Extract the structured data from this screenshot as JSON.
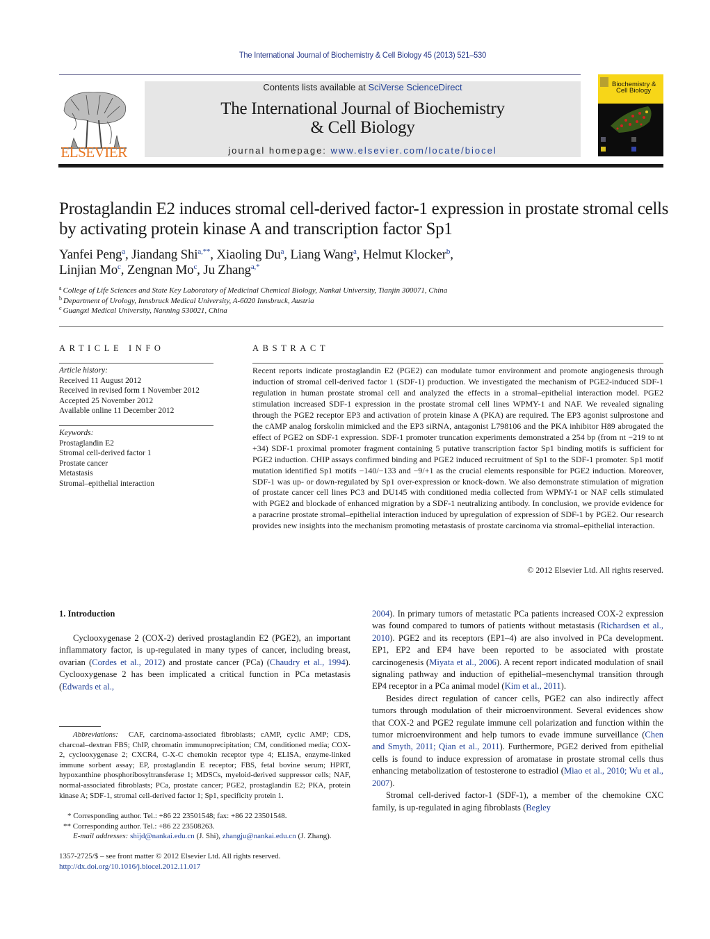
{
  "header": {
    "journal_ref": "The International Journal of Biochemistry & Cell Biology 45 (2013) 521–530",
    "contents_prefix": "Contents lists available at ",
    "contents_link": "SciVerse ScienceDirect",
    "journal_title_line1": "The International Journal of Biochemistry",
    "journal_title_line2": "& Cell Biology",
    "homepage_prefix": "journal homepage: ",
    "homepage_link": "www.elsevier.com/locate/biocel",
    "publisher_logo_text": "ELSEVIER",
    "cover_title_line1": "Biochemistry &",
    "cover_title_line2": "Cell Biology"
  },
  "article": {
    "title": "Prostaglandin E2 induces stromal cell-derived factor-1 expression in prostate stromal cells by activating protein kinase A and transcription factor Sp1",
    "authors": [
      {
        "name": "Yanfei Peng",
        "aff": "a"
      },
      {
        "name": "Jiandang Shi",
        "aff": "a,**"
      },
      {
        "name": "Xiaoling Du",
        "aff": "a"
      },
      {
        "name": "Liang Wang",
        "aff": "a"
      },
      {
        "name": "Helmut Klocker",
        "aff": "b"
      },
      {
        "name": "Linjian Mo",
        "aff": "c"
      },
      {
        "name": "Zengnan Mo",
        "aff": "c"
      },
      {
        "name": "Ju Zhang",
        "aff": "a,*"
      }
    ],
    "affiliations": [
      {
        "key": "a",
        "text": "College of Life Sciences and State Key Laboratory of Medicinal Chemical Biology, Nankai University, Tianjin 300071, China"
      },
      {
        "key": "b",
        "text": "Department of Urology, Innsbruck Medical University, A-6020 Innsbruck, Austria"
      },
      {
        "key": "c",
        "text": "Guangxi Medical University, Nanning 530021, China"
      }
    ]
  },
  "article_info": {
    "heading": "ARTICLE INFO",
    "history_label": "Article history:",
    "history": [
      "Received 11 August 2012",
      "Received in revised form 1 November 2012",
      "Accepted 25 November 2012",
      "Available online 11 December 2012"
    ],
    "keywords_label": "Keywords:",
    "keywords": [
      "Prostaglandin E2",
      "Stromal cell-derived factor 1",
      "Prostate cancer",
      "Metastasis",
      "Stromal–epithelial interaction"
    ]
  },
  "abstract": {
    "heading": "ABSTRACT",
    "text": "Recent reports indicate prostaglandin E2 (PGE2) can modulate tumor environment and promote angiogenesis through induction of stromal cell-derived factor 1 (SDF-1) production. We investigated the mechanism of PGE2-induced SDF-1 regulation in human prostate stromal cell and analyzed the effects in a stromal–epithelial interaction model. PGE2 stimulation increased SDF-1 expression in the prostate stromal cell lines WPMY-1 and NAF. We revealed signaling through the PGE2 receptor EP3 and activation of protein kinase A (PKA) are required. The EP3 agonist sulprostone and the cAMP analog forskolin mimicked and the EP3 siRNA, antagonist L798106 and the PKA inhibitor H89 abrogated the effect of PGE2 on SDF-1 expression. SDF-1 promoter truncation experiments demonstrated a 254 bp (from nt −219 to nt +34) SDF-1 proximal promoter fragment containing 5 putative transcription factor Sp1 binding motifs is sufficient for PGE2 induction. CHIP assays confirmed binding and PGE2 induced recruitment of Sp1 to the SDF-1 promoter. Sp1 motif mutation identified Sp1 motifs −140/−133 and −9/+1 as the crucial elements responsible for PGE2 induction. Moreover, SDF-1 was up- or down-regulated by Sp1 over-expression or knock-down. We also demonstrate stimulation of migration of prostate cancer cell lines PC3 and DU145 with conditioned media collected from WPMY-1 or NAF cells stimulated with PGE2 and blockade of enhanced migration by a SDF-1 neutralizing antibody. In conclusion, we provide evidence for a paracrine prostate stromal–epithelial interaction induced by upregulation of expression of SDF-1 by PGE2. Our research provides new insights into the mechanism promoting metastasis of prostate carcinoma via stromal–epithelial interaction.",
    "copyright": "© 2012 Elsevier Ltd. All rights reserved."
  },
  "introduction": {
    "heading": "1.  Introduction",
    "p1": [
      {
        "t": "Cyclooxygenase 2 (COX-2) derived prostaglandin E2 (PGE2), an important inflammatory factor, is up-regulated in many types of cancer, including breast, ovarian ("
      },
      {
        "t": "Cordes et al., 2012",
        "link": true
      },
      {
        "t": ") and prostate cancer (PCa) ("
      },
      {
        "t": "Chaudry et al., 1994",
        "link": true
      },
      {
        "t": "). Cyclooxygenase 2 has been implicated a critical function in PCa metastasis ("
      },
      {
        "t": "Edwards et al.,",
        "link": true
      }
    ],
    "p1_cont": [
      {
        "t": "2004",
        "link": true
      },
      {
        "t": "). In primary tumors of metastatic PCa patients increased COX-2 expression was found compared to tumors of patients without metastasis ("
      },
      {
        "t": "Richardsen et al., 2010",
        "link": true
      },
      {
        "t": "). PGE2 and its receptors (EP1–4) are also involved in PCa development. EP1, EP2 and EP4 have been reported to be associated with prostate carcinogenesis ("
      },
      {
        "t": "Miyata et al., 2006",
        "link": true
      },
      {
        "t": "). A recent report indicated modulation of snail signaling pathway and induction of epithelial–mesenchymal transition through EP4 receptor in a PCa animal model ("
      },
      {
        "t": "Kim et al., 2011",
        "link": true
      },
      {
        "t": ")."
      }
    ],
    "p2": [
      {
        "t": "Besides direct regulation of cancer cells, PGE2 can also indirectly affect tumors through modulation of their microenvironment. Several evidences show that COX-2 and PGE2 regulate immune cell polarization and function within the tumor microenvironment and help tumors to evade immune surveillance ("
      },
      {
        "t": "Chen and Smyth, 2011; Qian et al., 2011",
        "link": true
      },
      {
        "t": "). Furthermore, PGE2 derived from epithelial cells is found to induce expression of aromatase in prostate stromal cells thus enhancing metabolization of testosterone to estradiol ("
      },
      {
        "t": "Miao et al., 2010; Wu et al., 2007",
        "link": true
      },
      {
        "t": ")."
      }
    ],
    "p3": [
      {
        "t": "Stromal cell-derived factor-1 (SDF-1), a member of the chemokine CXC family, is up-regulated in aging fibroblasts ("
      },
      {
        "t": "Begley",
        "link": true
      }
    ]
  },
  "footnotes": {
    "abbreviations_label": "Abbreviations:",
    "abbreviations_text": "CAF, carcinoma-associated fibroblasts; cAMP, cyclic AMP; CDS, charcoal–dextran FBS; ChIP, chromatin immunoprecipitation; CM, conditioned media; COX-2, cyclooxygenase 2; CXCR4, C-X-C chemokin receptor type 4; ELISA, enzyme-linked immune sorbent assay; EP, prostaglandin E receptor; FBS, fetal bovine serum; HPRT, hypoxanthine phosphoribosyltransferase 1; MDSCs, myeloid-derived suppressor cells; NAF, normal-associated fibroblasts; PCa, prostate cancer; PGE2, prostaglandin E2; PKA, protein kinase A; SDF-1, stromal cell-derived factor 1; Sp1, specificity protein 1.",
    "corr1_mark": "*",
    "corr1_text": "Corresponding author. Tel.: +86 22 23501548; fax: +86 22 23501548.",
    "corr2_mark": "**",
    "corr2_text": "Corresponding author. Tel.: +86 22 23508263.",
    "email_label": "E-mail addresses:",
    "email1": "shijd@nankai.edu.cn",
    "email1_owner": "(J. Shi),",
    "email2": "zhangju@nankai.edu.cn",
    "email2_owner": "(J. Zhang).",
    "issn_line": "1357-2725/$ – see front matter © 2012 Elsevier Ltd. All rights reserved.",
    "doi": "http://dx.doi.org/10.1016/j.biocel.2012.11.017"
  }
}
